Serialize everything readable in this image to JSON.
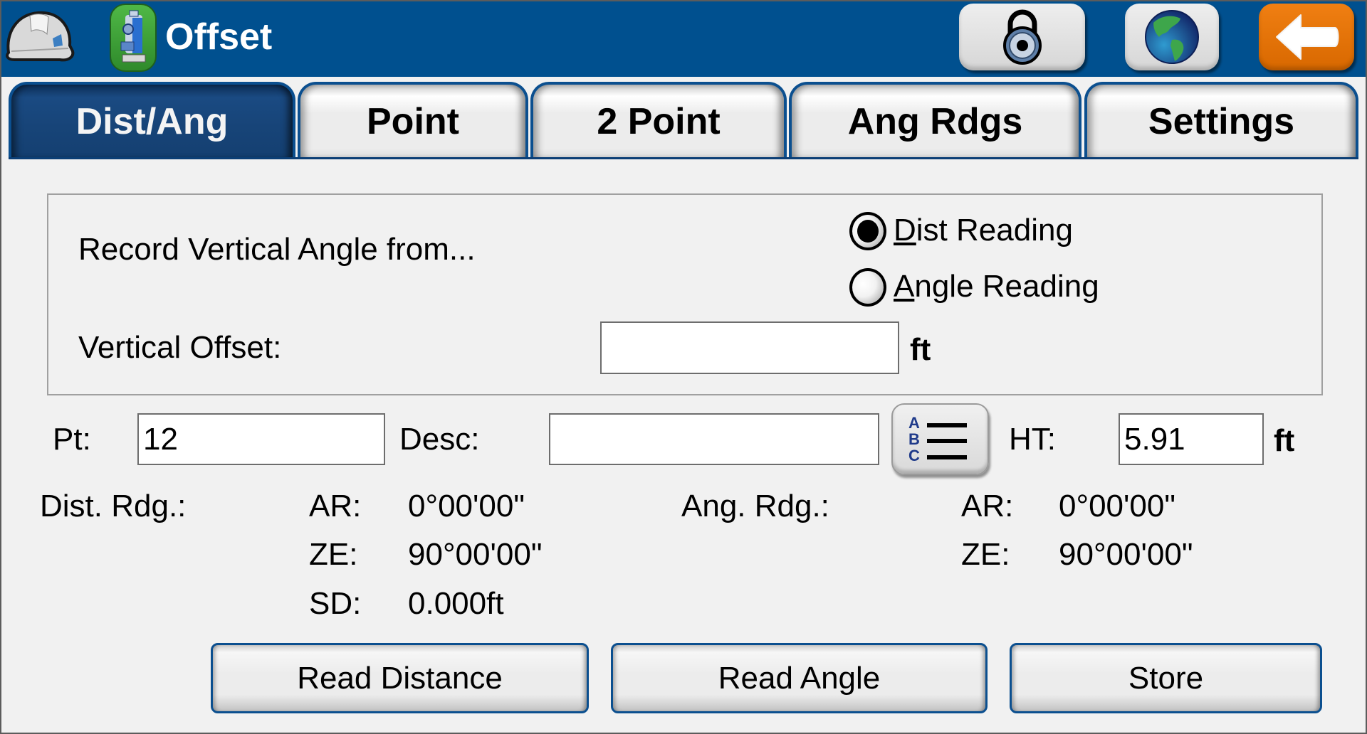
{
  "header": {
    "title": "Offset",
    "buttons": {
      "lock": "lock-icon",
      "globe": "globe-icon",
      "back": "back-arrow-icon"
    }
  },
  "tabs": [
    {
      "label": "Dist/Ang",
      "active": true
    },
    {
      "label": "Point",
      "active": false
    },
    {
      "label": "2 Point",
      "active": false
    },
    {
      "label": "Ang Rdgs",
      "active": false
    },
    {
      "label": "Settings",
      "active": false
    }
  ],
  "group": {
    "record_label": "Record Vertical Angle from...",
    "options": [
      {
        "label_underlined": "D",
        "label_rest": "ist Reading",
        "selected": true
      },
      {
        "label_underlined": "A",
        "label_rest": "ngle Reading",
        "selected": false
      }
    ],
    "vertical_offset_label": "Vertical Offset:",
    "vertical_offset_value": "",
    "vertical_offset_unit": "ft"
  },
  "point_row": {
    "pt_label": "Pt:",
    "pt_value": "12",
    "desc_label": "Desc:",
    "desc_value": "",
    "list_button_letters": [
      "A",
      "B",
      "C"
    ],
    "ht_label": "HT:",
    "ht_value": "5.91",
    "ht_unit": "ft"
  },
  "readings": {
    "dist": {
      "title": "Dist. Rdg.:",
      "rows": [
        {
          "label": "AR:",
          "value": "0°00'00\""
        },
        {
          "label": "ZE:",
          "value": "90°00'00\""
        },
        {
          "label": "SD:",
          "value": "0.000ft"
        }
      ]
    },
    "ang": {
      "title": "Ang. Rdg.:",
      "rows": [
        {
          "label": "AR:",
          "value": "0°00'00\""
        },
        {
          "label": "ZE:",
          "value": "90°00'00\""
        }
      ]
    }
  },
  "actions": {
    "read_distance": "Read Distance",
    "read_angle": "Read Angle",
    "store": "Store"
  },
  "colors": {
    "header_bg": "#00508f",
    "tab_active": "#174478",
    "back_button": "#e07000",
    "app_icon": "#3a9d35"
  }
}
